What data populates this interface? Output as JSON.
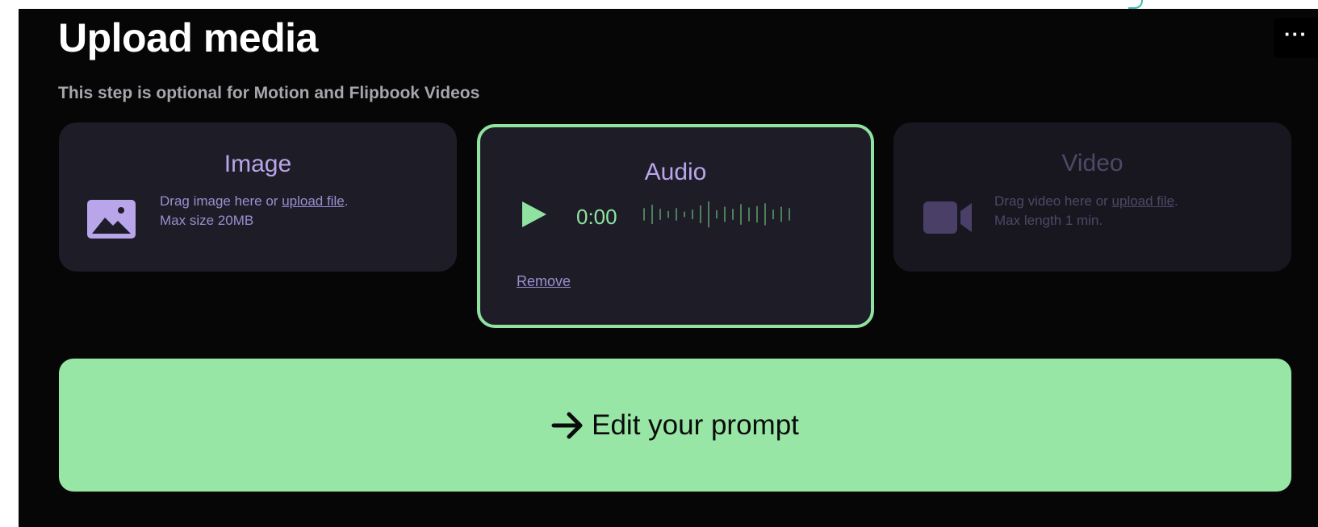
{
  "header": {
    "title": "Upload media",
    "subtitle": "This step is optional for Motion and Flipbook Videos",
    "more_label": "···"
  },
  "cards": {
    "image": {
      "title": "Image",
      "drop_text_prefix": "Drag image here or ",
      "drop_link": "upload file",
      "drop_text_suffix": ".",
      "limit": "Max size 20MB",
      "icon": "image-icon"
    },
    "audio": {
      "title": "Audio",
      "time": "0:00",
      "remove_label": "Remove",
      "icon": "play-icon",
      "waveform_levels": [
        0.45,
        0.7,
        0.4,
        0.25,
        0.45,
        0.2,
        0.35,
        0.65,
        0.95,
        0.3,
        0.55,
        0.4,
        0.75,
        0.5,
        0.6,
        0.8,
        0.35,
        0.55,
        0.45
      ]
    },
    "video": {
      "title": "Video",
      "drop_text_prefix": "Drag video here or ",
      "drop_link": "upload file",
      "drop_text_suffix": ".",
      "limit": "Max length 1 min.",
      "icon": "video-camera-icon"
    }
  },
  "cta": {
    "label": "Edit your prompt",
    "icon": "arrow-right-icon"
  },
  "colors": {
    "background": "#060606",
    "card": "#1e1d27",
    "accent_green": "#98e6a5",
    "accent_purple": "#b9a6ea"
  }
}
